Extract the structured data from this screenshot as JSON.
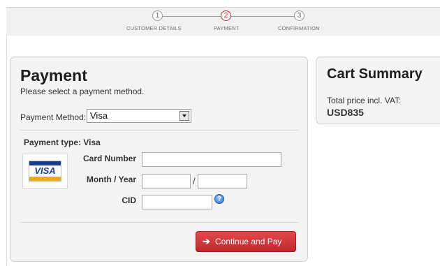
{
  "steps": [
    {
      "number": "1",
      "label": "CUSTOMER DETAILS"
    },
    {
      "number": "2",
      "label": "PAYMENT"
    },
    {
      "number": "3",
      "label": "CONFIRMATION"
    }
  ],
  "payment": {
    "title": "Payment",
    "subtitle": "Please select a payment method.",
    "method_label": "Payment Method:",
    "method_value": "Visa",
    "type_label": "Payment type: Visa",
    "card_logo": "VISA",
    "card_number_label": "Card Number",
    "card_number_value": "",
    "month_year_label": "Month / Year",
    "month_value": "",
    "year_value": "",
    "slash": "/",
    "cid_label": "CID",
    "cid_value": "",
    "help": "?",
    "continue_label": "Continue and Pay",
    "continue_arrow": "➔"
  },
  "cart": {
    "title": "Cart Summary",
    "total_label": "Total price incl. VAT:",
    "total_value": "USD835"
  },
  "colors": {
    "accent_red": "#c8232c",
    "visa_blue": "#1a3b8f",
    "visa_gold": "#f0a81c",
    "panel_bg": "#f4f4f4"
  }
}
